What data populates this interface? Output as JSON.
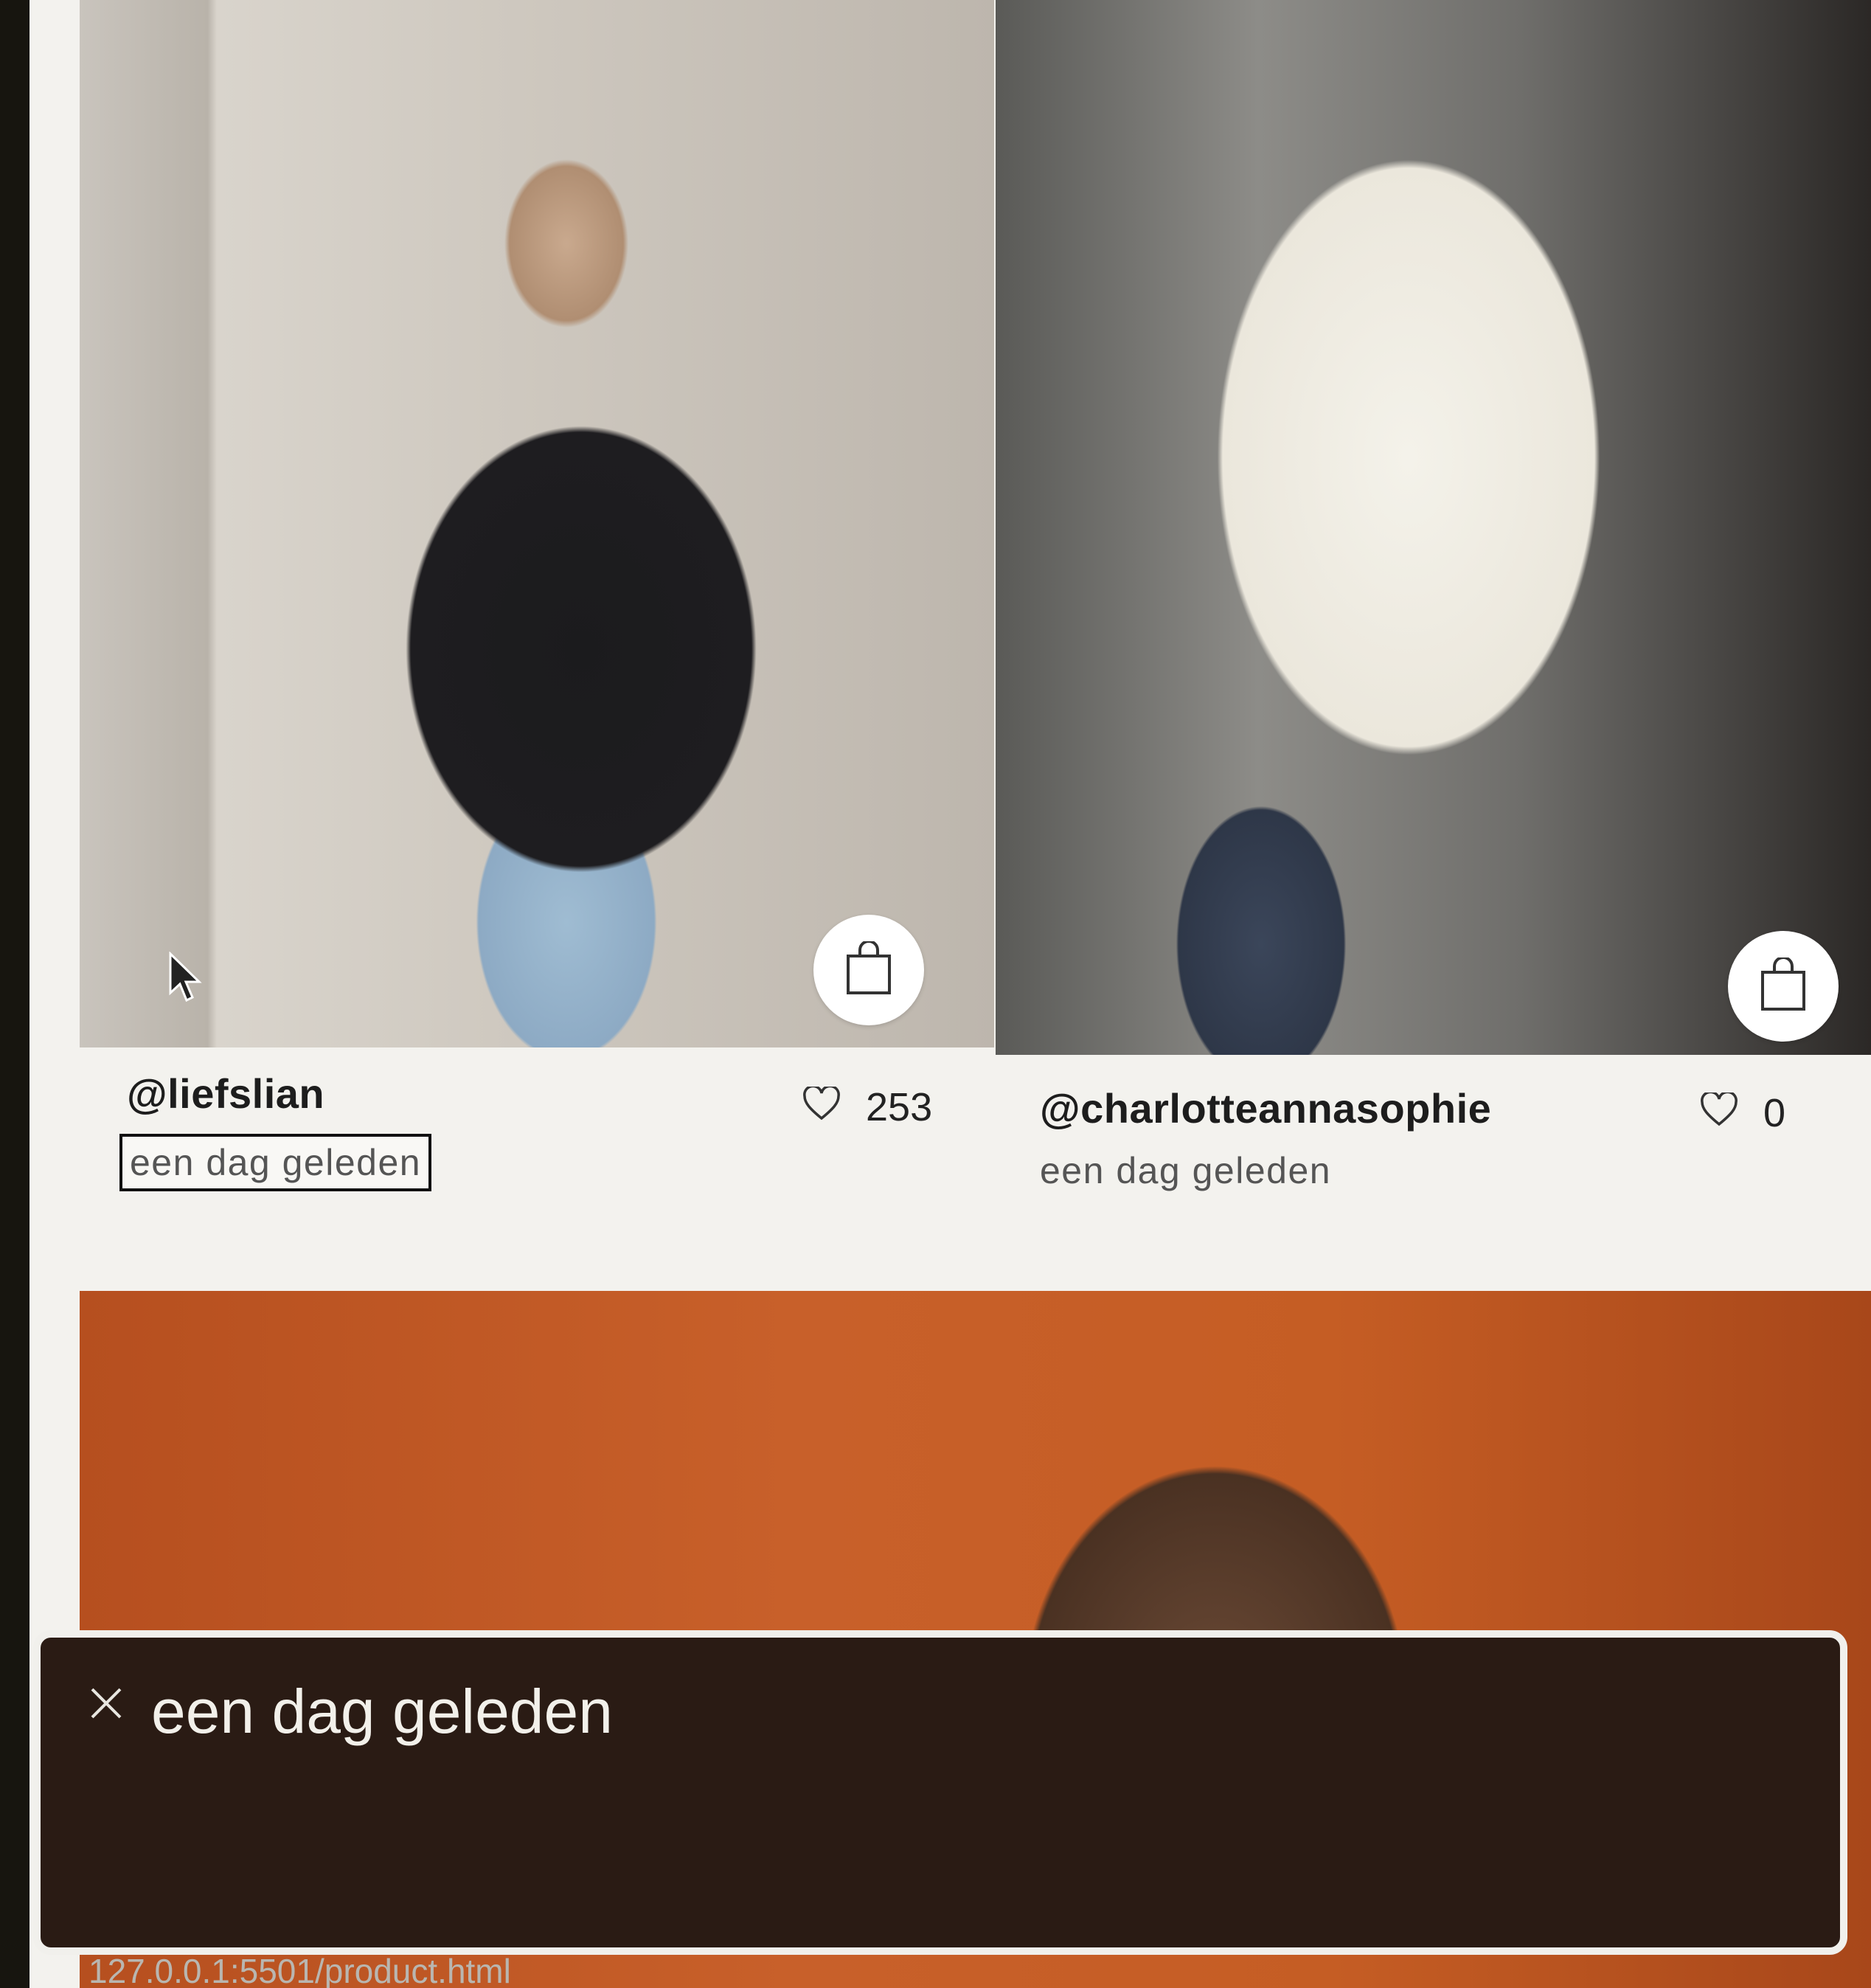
{
  "cards": [
    {
      "handle": "@liefslian",
      "timestamp": "een dag geleden",
      "likes": "253",
      "photo_icon": "bag-icon"
    },
    {
      "handle": "@charlotteannasophie",
      "timestamp": "een dag geleden",
      "likes": "0",
      "photo_icon": "bag-icon"
    }
  ],
  "tooltip": {
    "text": "een dag geleden",
    "close_icon": "close-icon"
  },
  "status_bar": {
    "url": "127.0.0.1:5501/product.html"
  },
  "colors": {
    "toast_background": "#2a1b14",
    "page_background": "#f3f2ee",
    "accent_orange": "#c55d24"
  }
}
